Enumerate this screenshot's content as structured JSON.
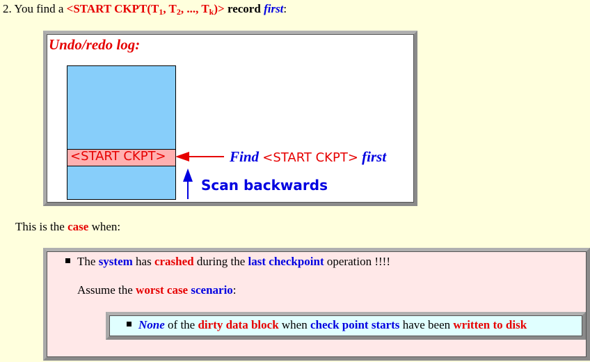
{
  "heading": {
    "number": "2.",
    "text1": "You find a",
    "record_open": "<START CKPT(T",
    "sub1": "1",
    "sep1": ", T",
    "sub2": "2",
    "sep2": ", ..., T",
    "subk": "k",
    "record_close": ")>",
    "record_word": "record",
    "first": "first",
    "colon": ":"
  },
  "log_figure": {
    "title": "Undo/redo  log:",
    "ckpt_record": "<START CKPT>",
    "find_word": "Find",
    "find_record": "<START CKPT>",
    "find_first": "first",
    "scan_label": "Scan backwards"
  },
  "case_line": {
    "text1": "This is the",
    "case": "case",
    "text2": "when:"
  },
  "case_box": {
    "item1": {
      "t1": "The",
      "system": "system",
      "t2": "has",
      "crashed": "crashed",
      "t3": "during the",
      "last_checkpoint": "last checkpoint",
      "t4": "operation !!!!"
    },
    "assume": {
      "t1": "Assume the",
      "worst_case": "worst case",
      "scenario": "scenario",
      "colon": ":"
    },
    "item2": {
      "none": "None",
      "t1": "of the",
      "dirty_block": "dirty data block",
      "t2": "when",
      "ckpt_starts": "check point starts",
      "t3": "have been",
      "written": "written to disk"
    }
  },
  "colors": {
    "red": "#e60000",
    "blue": "#0000e0",
    "log_block": "#87cefa",
    "ckpt_band": "#ffb0b0",
    "page_bg": "#ffffdd"
  }
}
